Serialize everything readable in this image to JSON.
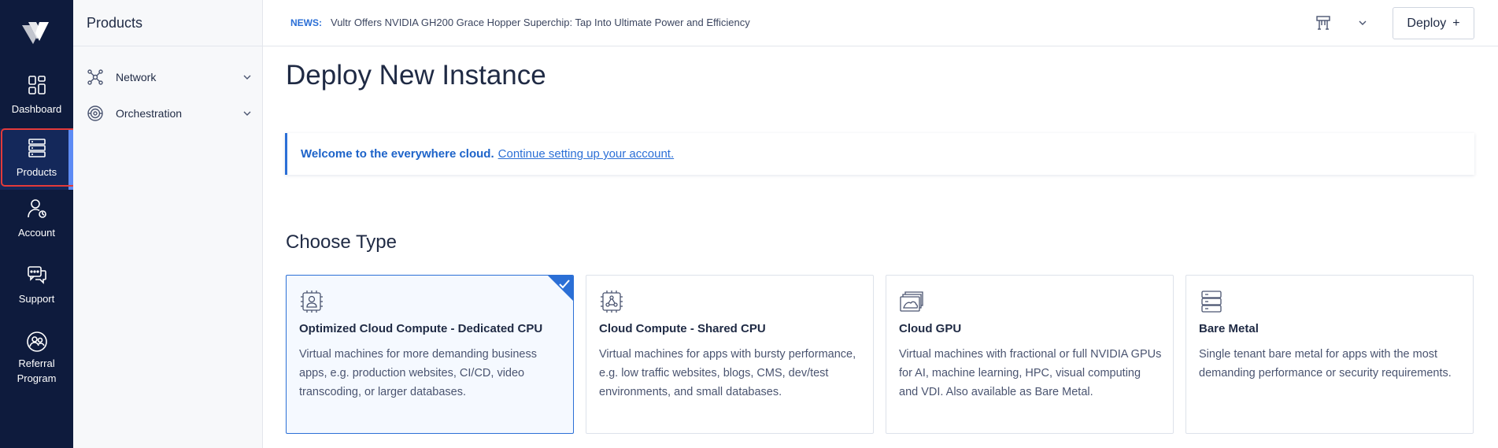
{
  "rail": {
    "items": [
      {
        "label": "Dashboard",
        "icon": "dashboard-icon"
      },
      {
        "label": "Products",
        "icon": "products-icon",
        "active": true
      },
      {
        "label": "Account",
        "icon": "account-icon"
      },
      {
        "label": "Support",
        "icon": "support-icon"
      },
      {
        "label": "Referral\nProgram",
        "icon": "referral-icon"
      }
    ]
  },
  "sidebar": {
    "title": "Products",
    "items": [
      {
        "label": "Network",
        "icon": "network-icon"
      },
      {
        "label": "Orchestration",
        "icon": "orchestration-icon"
      }
    ]
  },
  "topbar": {
    "news_tag": "NEWS:",
    "news_text": "Vultr Offers NVIDIA GH200 Grace Hopper Superchip: Tap Into Ultimate Power and Efficiency",
    "deploy_label": "Deploy",
    "deploy_symbol": "+"
  },
  "main": {
    "title": "Deploy New Instance",
    "welcome_bold": "Welcome to the everywhere cloud.",
    "welcome_link": "Continue setting up your account.",
    "section_title": "Choose Type",
    "cards": [
      {
        "title": "Optimized Cloud Compute - Dedicated CPU",
        "description": "Virtual machines for more demanding business apps, e.g. production websites, CI/CD, video transcoding, or larger databases.",
        "selected": true,
        "icon": "dedicated-cpu-icon"
      },
      {
        "title": "Cloud Compute - Shared CPU",
        "description": "Virtual machines for apps with bursty performance, e.g. low traffic websites, blogs, CMS, dev/test environments, and small databases.",
        "selected": false,
        "icon": "shared-cpu-icon"
      },
      {
        "title": "Cloud GPU",
        "description": "Virtual machines with fractional or full NVIDIA GPUs for AI, machine learning, HPC, visual computing and VDI. Also available as Bare Metal.",
        "selected": false,
        "icon": "gpu-icon"
      },
      {
        "title": "Bare Metal",
        "description": "Single tenant bare metal for apps with the most demanding performance or security requirements.",
        "selected": false,
        "icon": "bare-metal-icon"
      }
    ]
  },
  "colors": {
    "rail_bg": "#0e1b3d",
    "accent": "#2b6fd6",
    "highlight": "#e33a3a"
  }
}
